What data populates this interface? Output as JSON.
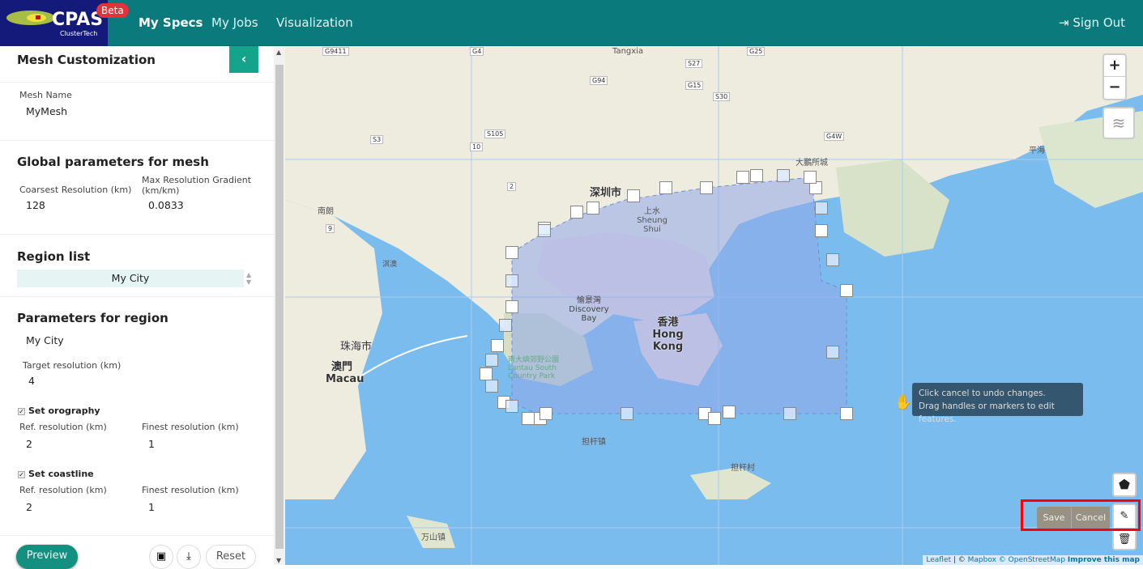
{
  "nav": {
    "brand": "CPAS",
    "brand_sub": "ClusterTech",
    "badge": "Beta",
    "items": [
      "My Specs",
      "My Jobs",
      "Visualization"
    ],
    "sign_out": "Sign Out"
  },
  "panel": {
    "title": "Mesh Customization",
    "collapse_icon": "chevron-left-icon",
    "mesh_name_label": "Mesh Name",
    "mesh_name": "MyMesh",
    "global_title": "Global parameters for mesh",
    "coarsest_label": "Coarsest Resolution (km)",
    "coarsest": "128",
    "gradient_label": "Max Resolution Gradient (km/km)",
    "gradient": "0.0833",
    "region_title": "Region list",
    "region_selected": "My City",
    "params_title": "Parameters for region",
    "region_name": "My City",
    "target_label": "Target resolution (km)",
    "target": "4",
    "orography": {
      "label": "Set orography",
      "checked": true,
      "ref_label": "Ref. resolution (km)",
      "ref": "2",
      "finest_label": "Finest resolution (km)",
      "finest": "1"
    },
    "coastline": {
      "label": "Set coastline",
      "checked": true,
      "ref_label": "Ref. resolution (km)",
      "ref": "2",
      "finest_label": "Finest resolution (km)",
      "finest": "1"
    },
    "preview": "Preview",
    "reset": "Reset"
  },
  "map": {
    "zoom_in": "+",
    "zoom_out": "−",
    "tooltip": [
      "Click cancel to undo changes.",
      "Drag handles or markers to edit features."
    ],
    "save": "Save",
    "cancel": "Cancel",
    "attribution": {
      "leaflet": "Leaflet",
      "sep": " | © ",
      "mapbox": "Mapbox",
      "osm": "© OpenStreetMap",
      "improve": "Improve this map"
    },
    "labels": [
      "Tangxia",
      "深圳市",
      "上水 Sheung Shui",
      "愉景灣 Discovery Bay",
      "香港 Hong Kong",
      "澳門 Macau",
      "珠海市",
      "南朗",
      "大鵬所城",
      "平海",
      "南大嶼郊野公園 Lantau South Country Park",
      "担杆镇",
      "担杆村",
      "万山镇",
      "淇澳"
    ],
    "roads": [
      "G9411",
      "G4",
      "G25",
      "S27",
      "G94",
      "G15",
      "S30",
      "S105",
      "S3",
      "G4W",
      "10",
      "9",
      "2"
    ]
  },
  "colors": {
    "nav": "#0b7a7c",
    "accent": "#14a38b",
    "water": "#7bbcee",
    "polygon": "#8fa8e8",
    "highlight": "#ff0000"
  }
}
